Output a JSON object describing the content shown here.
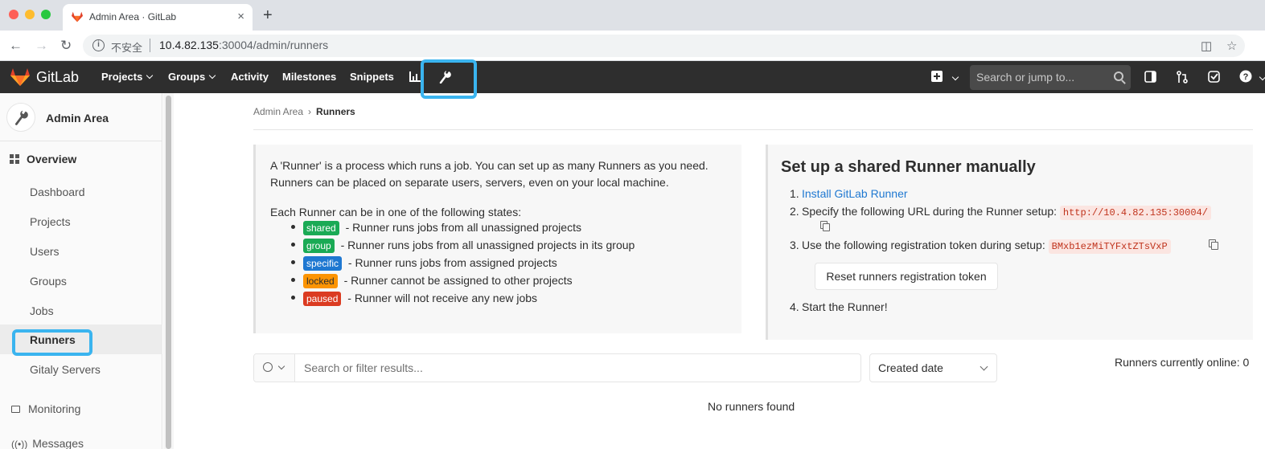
{
  "browser": {
    "tab_title": "Admin Area · GitLab",
    "tab_close": "×",
    "new_tab": "+",
    "insecure_label": "不安全",
    "url_host": "10.4.82.135",
    "url_rest": ":30004/admin/runners"
  },
  "navbar": {
    "brand": "GitLab",
    "items": [
      {
        "label": "Projects",
        "dropdown": true
      },
      {
        "label": "Groups",
        "dropdown": true
      },
      {
        "label": "Activity"
      },
      {
        "label": "Milestones"
      },
      {
        "label": "Snippets"
      }
    ],
    "search_placeholder": "Search or jump to..."
  },
  "sidebar": {
    "title": "Admin Area",
    "overview_label": "Overview",
    "items": [
      {
        "label": "Dashboard"
      },
      {
        "label": "Projects"
      },
      {
        "label": "Users"
      },
      {
        "label": "Groups"
      },
      {
        "label": "Jobs"
      },
      {
        "label": "Runners",
        "active": true
      },
      {
        "label": "Gitaly Servers"
      }
    ],
    "monitoring_label": "Monitoring",
    "messages_label": "Messages"
  },
  "breadcrumb": {
    "parent": "Admin Area",
    "separator": "›",
    "current": "Runners"
  },
  "info": {
    "intro_line1": "A 'Runner' is a process which runs a job. You can set up as many Runners as you need.",
    "intro_line2": "Runners can be placed on separate users, servers, even on your local machine.",
    "states_intro": "Each Runner can be in one of the following states:",
    "states": [
      {
        "badge": "shared",
        "color": "#1aaa55",
        "text": " - Runner runs jobs from all unassigned projects"
      },
      {
        "badge": "group",
        "color": "#1aaa55",
        "text": " - Runner runs jobs from all unassigned projects in its group"
      },
      {
        "badge": "specific",
        "color": "#1f78d1",
        "text": " - Runner runs jobs from assigned projects"
      },
      {
        "badge": "locked",
        "color": "#fc9403",
        "text": " - Runner cannot be assigned to other projects"
      },
      {
        "badge": "paused",
        "color": "#db3b21",
        "text": " - Runner will not receive any new jobs"
      }
    ]
  },
  "setup": {
    "title": "Set up a shared Runner manually",
    "step1_no": "1.",
    "step1_link": "Install GitLab Runner",
    "step2_no": "2.",
    "step2_text": "Specify the following URL during the Runner setup:",
    "step2_url": "http://10.4.82.135:30004/",
    "step3_no": "3.",
    "step3_text": "Use the following registration token during setup:",
    "step3_token": "BMxb1ezMiTYFxtZTsVxP",
    "reset_button": "Reset runners registration token",
    "step4_no": "4.",
    "step4_text": "Start the Runner!"
  },
  "filter": {
    "placeholder": "Search or filter results...",
    "sort_label": "Created date"
  },
  "online_text": "Runners currently online: 0",
  "empty_text": "No runners found",
  "colors": {
    "highlight": "#3ab4ef",
    "navbar": "#2e2e2e",
    "link": "#1f78d1"
  }
}
